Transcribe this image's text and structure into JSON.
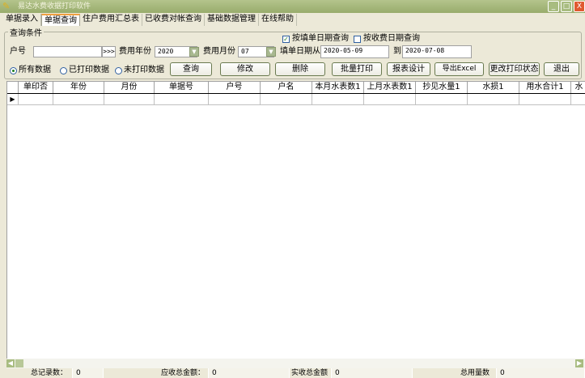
{
  "window": {
    "title": "易达水费收据打印软件",
    "minimize": "_",
    "maximize": "□",
    "close": "X"
  },
  "tabs": [
    "单据录入",
    "单据查询",
    "住户费用汇总表",
    "已收费对帐查询",
    "基础数据管理",
    "在线帮助"
  ],
  "query": {
    "group_label": "查询条件",
    "account_label": "户号",
    "account_value": "",
    "lookup_button": ">>>",
    "year_label": "费用年份",
    "year_value": "2020",
    "month_label": "费用月份",
    "month_value": "07",
    "by_fill_date_label": "按填单日期查询",
    "by_fill_date_checked": true,
    "by_pay_date_label": "按收费日期查询",
    "by_pay_date_checked": false,
    "date_from_label": "填单日期从",
    "date_from": "2020-05-09",
    "date_to_label": "到",
    "date_to": "2020-07-08",
    "radios": [
      {
        "label": "所有数据",
        "selected": true
      },
      {
        "label": "已打印数据",
        "selected": false
      },
      {
        "label": "未打印数据",
        "selected": false
      }
    ],
    "buttons": {
      "query": "查询",
      "edit": "修改",
      "delete": "删除",
      "batch_print": "批量打印",
      "report_design": "报表设计",
      "export_excel": "导出Excel",
      "change_status": "更改打印状态",
      "exit": "退出"
    }
  },
  "grid": {
    "columns": [
      "单印否",
      "年份",
      "月份",
      "单据号",
      "户号",
      "户名",
      "本月水表数1",
      "上月水表数1",
      "抄见水量1",
      "水损1",
      "用水合计1",
      "水"
    ]
  },
  "status": {
    "total_records_label": "总记录数：",
    "total_records": "0",
    "receivable_label": "应收总金额：",
    "receivable": "0",
    "received_label": "实收总金额",
    "received": "0",
    "total_usage_label": "总用量数",
    "total_usage": "0"
  }
}
